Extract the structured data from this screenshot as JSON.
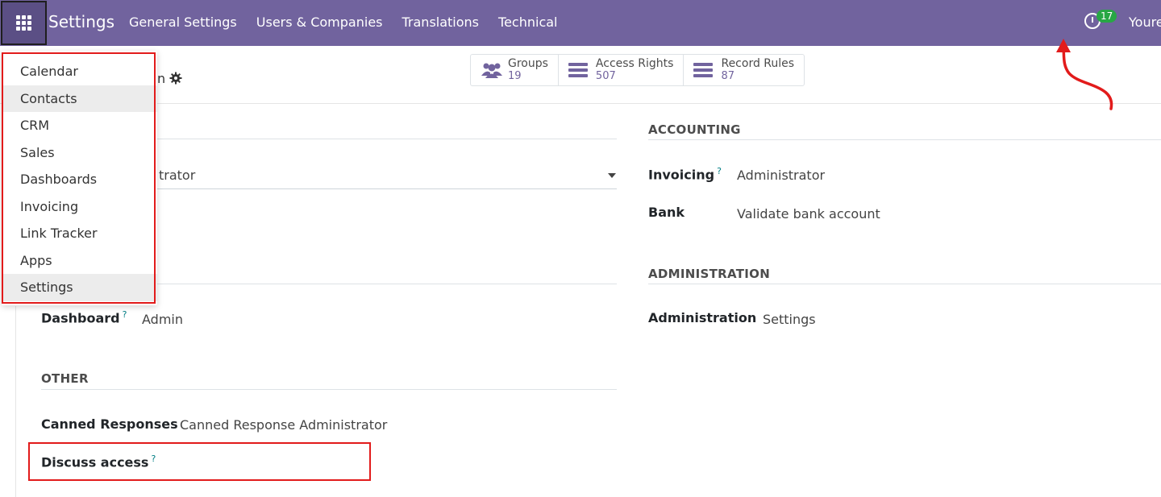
{
  "navbar": {
    "brand": "Settings",
    "menu": [
      "General Settings",
      "Users & Companies",
      "Translations",
      "Technical"
    ],
    "activity_count": "17",
    "user_name": "Youre"
  },
  "smart_buttons": [
    {
      "label": "Groups",
      "value": "19",
      "icon": "users-icon"
    },
    {
      "label": "Access Rights",
      "value": "507",
      "icon": "list-icon"
    },
    {
      "label": "Record Rules",
      "value": "87",
      "icon": "list-icon"
    }
  ],
  "page_title_fragment": "n",
  "apps_menu": {
    "items": [
      "Calendar",
      "Contacts",
      "CRM",
      "Sales",
      "Dashboards",
      "Invoicing",
      "Link Tracker",
      "Apps",
      "Settings"
    ]
  },
  "left": {
    "select_value_fragment": "trator",
    "dashboard_label": "Dashboard",
    "dashboard_value": "Admin",
    "other_title": "OTHER",
    "canned_label": "Canned Responses",
    "canned_value": "Canned Response Administrator",
    "discuss_label": "Discuss access",
    "help_mark": "?"
  },
  "right": {
    "accounting_title": "ACCOUNTING",
    "invoicing_label": "Invoicing",
    "invoicing_value": "Administrator",
    "bank_label": "Bank",
    "bank_value": "Validate bank account",
    "administration_title": "ADMINISTRATION",
    "administration_label": "Administration",
    "administration_value": "Settings"
  },
  "colors": {
    "navbar": "#71639e",
    "annotation": "#e21b1b",
    "help": "#017e84"
  }
}
